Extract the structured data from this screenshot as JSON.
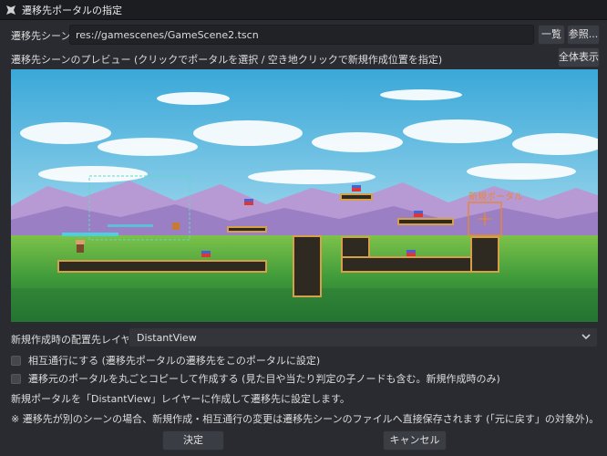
{
  "window": {
    "title": "遷移先ポータルの指定"
  },
  "scene": {
    "label": "遷移先シーン",
    "path": "res://gamescenes/GameScene2.tscn",
    "list_button": "一覧",
    "browse_button": "参照..."
  },
  "preview": {
    "label": "遷移先シーンのプレビュー (クリックでポータルを選択 / 空き地クリックで新規作成位置を指定)",
    "fit_button": "全体表示",
    "new_portal_marker": "新規ポータル"
  },
  "layer": {
    "label": "新規作成時の配置先レイヤー",
    "selected": "DistantView"
  },
  "options": {
    "mutual": "相互通行にする (遷移先ポータルの遷移先をこのポータルに設定)",
    "copy": "遷移元のポータルを丸ごとコピーして作成する (見た目や当たり判定の子ノードも含む。新規作成時のみ)"
  },
  "info": {
    "line1": "新規ポータルを「DistantView」レイヤーに作成して遷移先に設定します。",
    "line2": "※ 遷移先が別のシーンの場合、新規作成・相互通行の変更は遷移先シーンのファイルへ直接保存されます (「元に戻す」の対象外)。"
  },
  "buttons": {
    "ok": "決定",
    "cancel": "キャンセル"
  },
  "colors": {
    "accent": "#e8863a",
    "bg": "#2a2b30"
  }
}
